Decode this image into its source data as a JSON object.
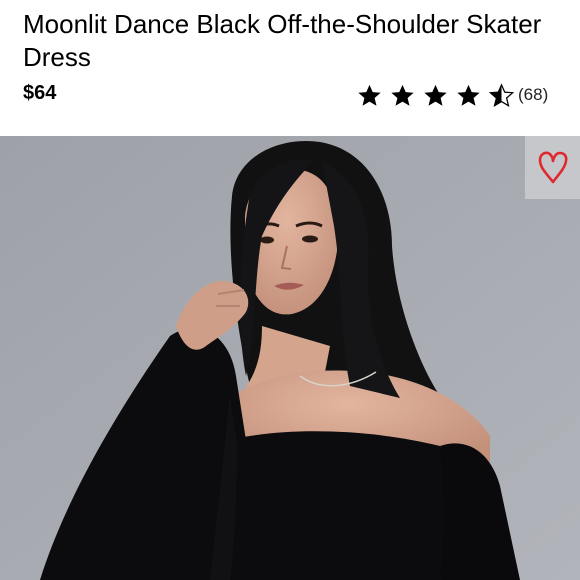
{
  "product": {
    "title": "Moonlit Dance Black Off-the-Shoulder Skater Dress",
    "price": "$64",
    "rating": {
      "stars": 4.5,
      "max": 5,
      "count_text": "(68)"
    }
  },
  "icons": {
    "rating_star": "star-icon",
    "favorite": "heart-icon"
  },
  "colors": {
    "heart": "#e0282f",
    "dress": "#0c0c0e",
    "background": "#a8abb1"
  }
}
